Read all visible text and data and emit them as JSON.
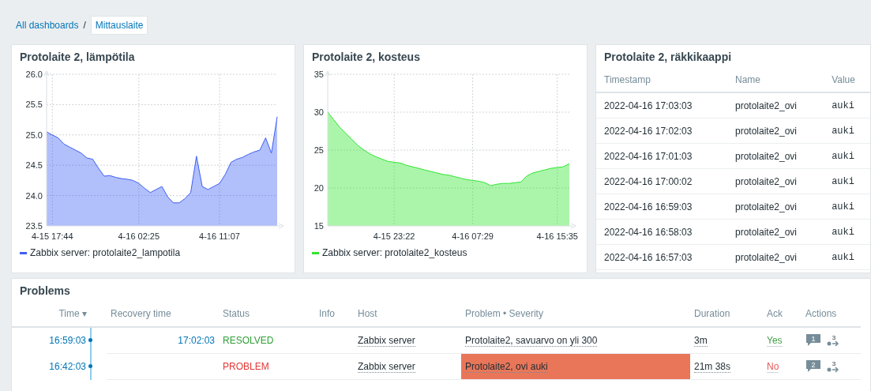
{
  "breadcrumb_separator": "/",
  "breadcrumbs": [
    {
      "label": "All dashboards",
      "selected": false
    },
    {
      "label": "Mittauslaite",
      "selected": true
    }
  ],
  "graphs": [
    {
      "title": "Protolaite 2, lämpötila",
      "chart_data": {
        "type": "area",
        "categories": [
          null,
          "4-15 17:44",
          null,
          null,
          null,
          null,
          null,
          null,
          null,
          null,
          null,
          null,
          null,
          null,
          null,
          null,
          "4-16 02:25",
          null,
          null,
          null,
          null,
          null,
          null,
          null,
          null,
          null,
          null,
          null,
          null,
          null,
          "4-16 11:07",
          null,
          null,
          null,
          null,
          null,
          null,
          null,
          null,
          null,
          null
        ],
        "series": [
          {
            "name": "Zabbix server: protolaite2_lampotila",
            "color": "#3d5ff5",
            "values": [
              25.05,
              25.0,
              24.95,
              24.85,
              24.8,
              24.75,
              24.7,
              24.62,
              24.6,
              24.45,
              24.32,
              24.33,
              24.3,
              24.28,
              24.27,
              24.25,
              24.2,
              24.12,
              24.05,
              24.1,
              24.15,
              23.98,
              23.88,
              23.88,
              23.95,
              24.05,
              24.65,
              24.15,
              24.1,
              24.15,
              24.2,
              24.35,
              24.55,
              24.6,
              24.63,
              24.68,
              24.72,
              24.75,
              24.95,
              24.7,
              25.3
            ]
          }
        ],
        "ylim": [
          23.5,
          26.0
        ],
        "grid": true,
        "yticks": [
          {
            "value": 23.5,
            "label": "23.5"
          },
          {
            "value": 24,
            "label": "24.0"
          },
          {
            "value": 24.5,
            "label": "24.5"
          },
          {
            "value": 25,
            "label": "25.0"
          },
          {
            "value": 25.5,
            "label": "25.5"
          },
          {
            "value": 26,
            "label": "26.0"
          }
        ]
      }
    },
    {
      "title": "Protolaite 2, kosteus",
      "chart_data": {
        "type": "area",
        "categories": [
          null,
          null,
          null,
          null,
          null,
          null,
          null,
          null,
          null,
          null,
          null,
          "4-15 23:22",
          null,
          null,
          null,
          null,
          null,
          null,
          null,
          null,
          null,
          null,
          null,
          null,
          "4-16 07:29",
          null,
          null,
          null,
          null,
          null,
          null,
          null,
          null,
          null,
          null,
          null,
          null,
          null,
          "4-16 15:35",
          null,
          null
        ],
        "series": [
          {
            "name": "Zabbix server: protolaite2_kosteus",
            "color": "#2ee62e",
            "values": [
              30,
              29,
              28,
              27.2,
              26.4,
              25.6,
              25,
              24.5,
              24.1,
              23.8,
              23.5,
              23.4,
              23.3,
              23.0,
              22.8,
              22.6,
              22.4,
              22.2,
              22,
              21.8,
              21.7,
              21.5,
              21.3,
              21.1,
              21,
              20.9,
              20.7,
              20.3,
              20.5,
              20.6,
              20.6,
              20.7,
              20.8,
              21.6,
              22.0,
              22.2,
              22.4,
              22.6,
              22.7,
              22.8,
              23.2
            ]
          }
        ],
        "ylim": [
          15,
          35
        ],
        "grid": true,
        "yticks": [
          15,
          20,
          25,
          30,
          35
        ]
      }
    }
  ],
  "history": {
    "title": "Protolaite 2, räkkikaappi",
    "columns": [
      "Timestamp",
      "Name",
      "Value"
    ],
    "rows": [
      [
        "2022-04-16 17:03:03",
        "protolaite2_ovi",
        "auki"
      ],
      [
        "2022-04-16 17:02:03",
        "protolaite2_ovi",
        "auki"
      ],
      [
        "2022-04-16 17:01:03",
        "protolaite2_ovi",
        "auki"
      ],
      [
        "2022-04-16 17:00:02",
        "protolaite2_ovi",
        "auki"
      ],
      [
        "2022-04-16 16:59:03",
        "protolaite2_ovi",
        "auki"
      ],
      [
        "2022-04-16 16:58:03",
        "protolaite2_ovi",
        "auki"
      ],
      [
        "2022-04-16 16:57:03",
        "protolaite2_ovi",
        "auki"
      ]
    ]
  },
  "problems": {
    "title": "Problems",
    "columns": [
      "Time ▾",
      "Recovery time",
      "Status",
      "Info",
      "Host",
      "Problem • Severity",
      "Duration",
      "Ack",
      "Actions"
    ],
    "rows": [
      {
        "time": "16:59:03",
        "recovery_time": "17:02:03",
        "status": "RESOLVED",
        "resolved": true,
        "host": "Zabbix server",
        "problem": "Protolaite2, savuarvo on yli 300",
        "duration": "3m",
        "ack": "Yes",
        "acknowledged": true,
        "messages": "1",
        "actions": "3"
      },
      {
        "time": "16:42:03",
        "status": "PROBLEM",
        "resolved": false,
        "host": "Zabbix server",
        "problem": "Protolaite2, ovi auki",
        "color": "#e97659",
        "duration": "21m 38s",
        "ack": "No",
        "acknowledged": false,
        "messages": "2",
        "actions": "3"
      }
    ]
  }
}
